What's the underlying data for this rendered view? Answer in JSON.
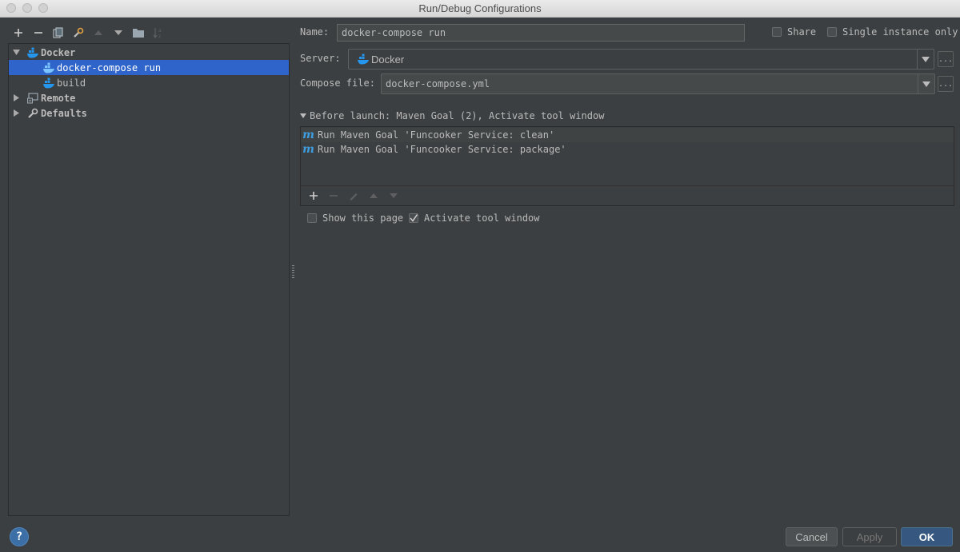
{
  "window": {
    "title": "Run/Debug Configurations"
  },
  "toolbar": {
    "icons": [
      "add-icon",
      "remove-icon",
      "copy-icon",
      "wrench-icon",
      "move-up-icon",
      "move-down-icon",
      "folder-icon",
      "sort-icon"
    ]
  },
  "tree": {
    "items": [
      {
        "label": "Docker",
        "icon": "docker-icon",
        "expanded": true
      },
      {
        "label": "docker-compose run",
        "icon": "docker-icon",
        "selected": true
      },
      {
        "label": "build",
        "icon": "docker-icon"
      },
      {
        "label": "Remote",
        "icon": "remote-icon",
        "expanded": false
      },
      {
        "label": "Defaults",
        "icon": "defaults-icon",
        "expanded": false
      }
    ]
  },
  "form": {
    "name_label": "Name:",
    "name_value": "docker-compose run",
    "share_label": "Share",
    "share_checked": false,
    "single_instance_label": "Single instance only",
    "single_instance_checked": false,
    "server_label": "Server:",
    "server_value": "Docker",
    "compose_label": "Compose file:",
    "compose_value": "docker-compose.yml",
    "ellipsis": "..."
  },
  "before_launch": {
    "header": "Before launch: Maven Goal (2), Activate tool window",
    "tasks": [
      "Run Maven Goal 'Funcooker Service: clean'",
      "Run Maven Goal 'Funcooker Service: package'"
    ],
    "maven_glyph": "m"
  },
  "options": {
    "show_page_label": "Show this page",
    "show_page_checked": false,
    "activate_label": "Activate tool window",
    "activate_checked": true
  },
  "footer": {
    "help": "?",
    "cancel": "Cancel",
    "apply": "Apply",
    "ok": "OK"
  },
  "colors": {
    "background": "#3c3f41",
    "selection": "#2f65ca",
    "docker_blue": "#2496ed",
    "maven_blue": "#3e9ee0",
    "ok_button": "#365880"
  }
}
